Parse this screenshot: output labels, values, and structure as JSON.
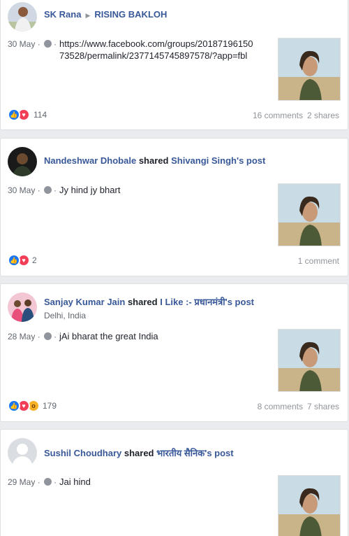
{
  "posts": [
    {
      "author": "SK Rana",
      "target": "RISING BAKLOH",
      "date": "30 May",
      "text": "https://www.facebook.com/groups/2018719615073528/permalink/2377145745897578/?app=fbl",
      "text_line1": "https://www.facebook.com/groups/20187196150",
      "text_line2": "73528/permalink/2377145745897578/?app=fbl",
      "reactions": [
        "like",
        "love"
      ],
      "reaction_count": "114",
      "comments": "16 comments",
      "shares": "2 shares"
    },
    {
      "author": "Nandeshwar Dhobale",
      "verb": "shared",
      "shared_from": "Shivangi Singh's post",
      "date": "30 May",
      "text": "Jy hind jy bhart",
      "reactions": [
        "like",
        "love"
      ],
      "reaction_count": "2",
      "comments": "1 comment"
    },
    {
      "author": "Sanjay Kumar Jain",
      "verb": "shared",
      "shared_from": "I Like :- प्रधानमंत्री's post",
      "location": "Delhi, India",
      "date": "28 May",
      "text": "jAi bharat the great India",
      "reactions": [
        "like",
        "love",
        "wow"
      ],
      "reaction_count": "179",
      "comments": "8 comments",
      "shares": "7 shares"
    },
    {
      "author": "Sushil Choudhary",
      "verb": "shared",
      "shared_from": "भारतीय सैनिक's post",
      "date": "29 May",
      "text": "Jai hind"
    }
  ],
  "colors": {
    "link": "#385898",
    "like": "#1877f2",
    "love": "#f33e58",
    "wow": "#f7b125",
    "background": "#e9ebee"
  },
  "icons": {
    "audience": "globe-icon",
    "separator": "triangle-right-icon"
  }
}
